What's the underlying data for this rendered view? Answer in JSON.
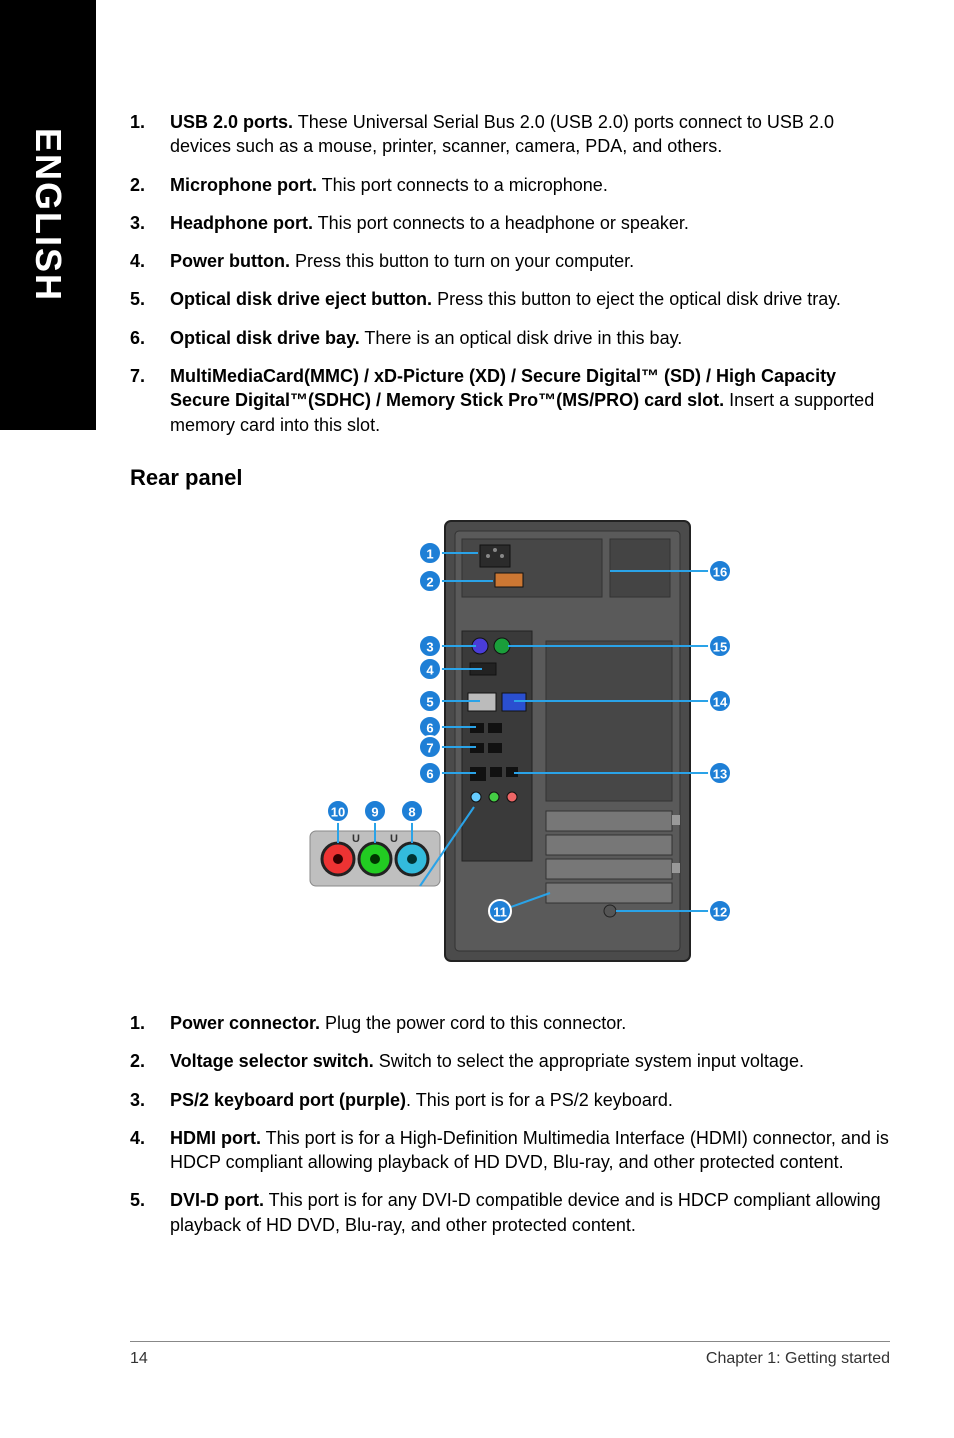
{
  "side_tab": "ENGLISH",
  "front_list": [
    {
      "num": "1.",
      "bold": "USB 2.0 ports.",
      "rest": " These Universal Serial Bus 2.0 (USB 2.0) ports connect to USB 2.0 devices such as a mouse, printer, scanner, camera, PDA, and others."
    },
    {
      "num": "2.",
      "bold": "Microphone port.",
      "rest": " This port connects to a microphone."
    },
    {
      "num": "3.",
      "bold": "Headphone port.",
      "rest": " This port connects to a headphone or speaker."
    },
    {
      "num": "4.",
      "bold": "Power button.",
      "rest": " Press this button to turn on your computer."
    },
    {
      "num": "5.",
      "bold": "Optical disk drive eject button.",
      "rest": " Press this button to eject the optical disk drive tray."
    },
    {
      "num": "6.",
      "bold": "Optical disk drive bay.",
      "rest": " There is an optical disk drive in this bay."
    },
    {
      "num": "7.",
      "bold": "MultiMediaCard(MMC) / xD-Picture (XD) / Secure Digital™ (SD) / High Capacity Secure Digital™(SDHC) / Memory Stick Pro™(MS/PRO) card slot.",
      "rest": " Insert a supported memory card into this slot."
    }
  ],
  "section_heading": "Rear panel",
  "rear_list": [
    {
      "num": "1.",
      "bold": "Power connector.",
      "rest": " Plug the power cord to this connector."
    },
    {
      "num": "2.",
      "bold": "Voltage selector switch.",
      "rest": " Switch to select the appropriate system input voltage."
    },
    {
      "num": "3.",
      "bold": "PS/2 keyboard port (purple)",
      "rest": ". This port is for a PS/2 keyboard."
    },
    {
      "num": "4.",
      "bold": "HDMI port.",
      "rest": " This port is for a High-Definition Multimedia Interface (HDMI) connector, and is HDCP compliant allowing playback of HD DVD, Blu-ray, and other protected content."
    },
    {
      "num": "5.",
      "bold": "DVI-D port.",
      "rest": " This port is for any DVI-D compatible device and is HDCP compliant allowing playback of HD DVD, Blu-ray, and other protected content."
    }
  ],
  "callouts_left": [
    "1",
    "2",
    "3",
    "4",
    "5",
    "6",
    "7",
    "6",
    "10",
    "9",
    "8",
    "11"
  ],
  "callouts_right": [
    "16",
    "15",
    "14",
    "13",
    "12"
  ],
  "audio_labels": [
    "U",
    "U"
  ],
  "footer_left": "14",
  "footer_right": "Chapter 1: Getting started"
}
